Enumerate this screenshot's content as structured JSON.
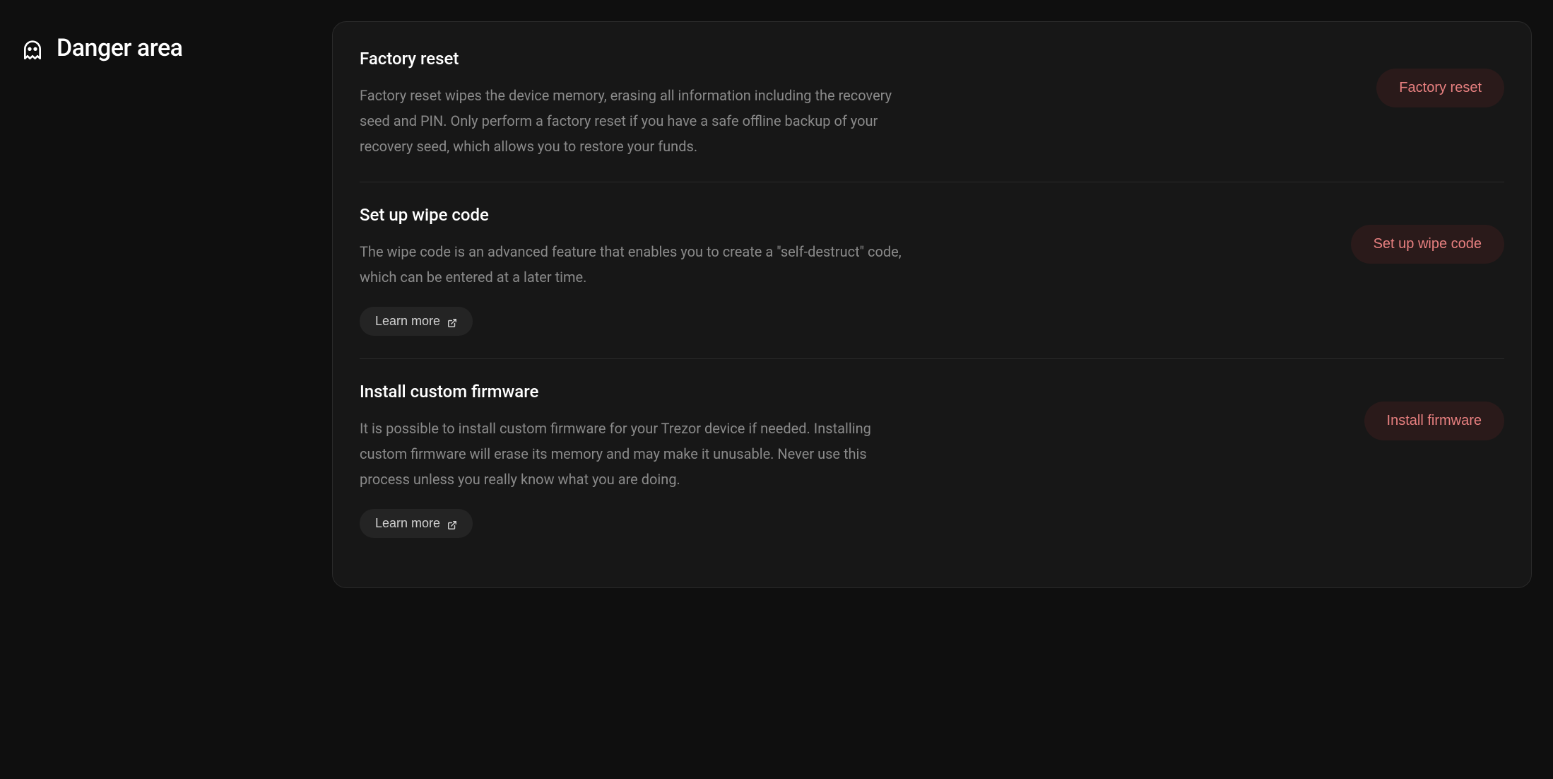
{
  "sidebar": {
    "title": "Danger area"
  },
  "sections": {
    "factory_reset": {
      "title": "Factory reset",
      "description": "Factory reset wipes the device memory, erasing all information including the recovery seed and PIN. Only perform a factory reset if you have a safe offline backup of your recovery seed, which allows you to restore your funds.",
      "action_label": "Factory reset"
    },
    "wipe_code": {
      "title": "Set up wipe code",
      "description": "The wipe code is an advanced feature that enables you to create a \"self-destruct\" code, which can be entered at a later time.",
      "learn_more_label": "Learn more",
      "action_label": "Set up wipe code"
    },
    "custom_firmware": {
      "title": "Install custom firmware",
      "description": "It is possible to install custom firmware for your Trezor device if needed. Installing custom firmware will erase its memory and may make it unusable. Never use this process unless you really know what you are doing.",
      "learn_more_label": "Learn more",
      "action_label": "Install firmware"
    }
  }
}
